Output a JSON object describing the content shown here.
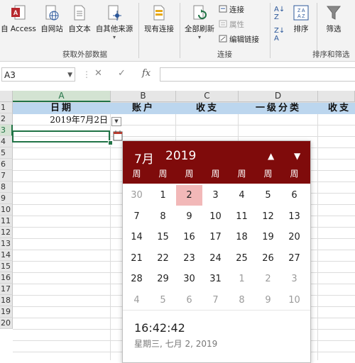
{
  "ribbon": {
    "buttons": [
      {
        "label": "自 Access",
        "icon": "access-icon"
      },
      {
        "label": "自网站",
        "icon": "web-icon"
      },
      {
        "label": "自文本",
        "icon": "text-file-icon"
      },
      {
        "label": "自其他来源",
        "icon": "other-sources-icon"
      },
      {
        "label": "现有连接",
        "icon": "existing-connections-icon"
      },
      {
        "label": "全部刷新",
        "icon": "refresh-all-icon"
      },
      {
        "label": "排序",
        "icon": "sort-icon"
      },
      {
        "label": "筛选",
        "icon": "filter-icon"
      }
    ],
    "small": {
      "connections": "连接",
      "properties": "属性",
      "edit_links": "编辑链接"
    },
    "groups": {
      "get_external": "获取外部数据",
      "connections": "连接",
      "sort_filter": "排序和筛选"
    },
    "colors": {
      "access_red": "#c0392b",
      "sort_blue": "#2b579a"
    }
  },
  "formula_bar": {
    "name_box": "A3",
    "cancel": "✕",
    "enter": "✓",
    "fx": "fx",
    "value": ""
  },
  "grid": {
    "columns": [
      "A",
      "B",
      "C",
      "D",
      ""
    ],
    "rows": [
      "1",
      "2",
      "3",
      "4",
      "5",
      "6",
      "7",
      "8",
      "9",
      "10",
      "11",
      "12",
      "13",
      "14",
      "15",
      "16",
      "17",
      "18",
      "19",
      "20"
    ],
    "header_row": {
      "a": "日期",
      "b": "账户",
      "c": "收支",
      "d": "一级分类",
      "e": "收支"
    },
    "a2": "2019年7月2日",
    "colors": {
      "header_fill": "#bcd6ee",
      "selection": "#217346"
    }
  },
  "picker": {
    "month": "7月",
    "year": "2019",
    "weekdays": [
      "周",
      "周",
      "周",
      "周",
      "周",
      "周",
      "周"
    ],
    "days": [
      [
        "30",
        "1",
        "2",
        "3",
        "4",
        "5",
        "6"
      ],
      [
        "7",
        "8",
        "9",
        "10",
        "11",
        "12",
        "13"
      ],
      [
        "14",
        "15",
        "16",
        "17",
        "18",
        "19",
        "20"
      ],
      [
        "21",
        "22",
        "23",
        "24",
        "25",
        "26",
        "27"
      ],
      [
        "28",
        "29",
        "30",
        "31",
        "1",
        "2",
        "3"
      ],
      [
        "4",
        "5",
        "6",
        "7",
        "8",
        "9",
        "10"
      ]
    ],
    "time": "16:42:42",
    "date_line": "星期三, 七月 2, 2019",
    "colors": {
      "header": "#7f0b0b",
      "selected": "#f2b8b8"
    }
  }
}
